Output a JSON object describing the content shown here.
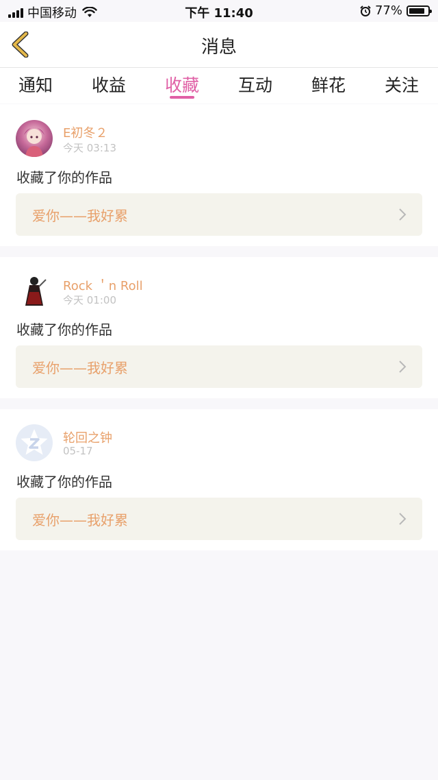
{
  "status": {
    "carrier": "中国移动",
    "time": "下午 11:40",
    "battery": "77%"
  },
  "nav": {
    "title": "消息"
  },
  "tabs": [
    {
      "label": "通知"
    },
    {
      "label": "收益"
    },
    {
      "label": "收藏"
    },
    {
      "label": "互动"
    },
    {
      "label": "鲜花"
    },
    {
      "label": "关注"
    }
  ],
  "active_tab": "收藏",
  "items": [
    {
      "name": "E初冬２",
      "time": "今天 03:13",
      "action": "收藏了你的作品",
      "work": "爱你——我好累"
    },
    {
      "name": "Rock ＇n Roll",
      "time": "今天 01:00",
      "action": "收藏了你的作品",
      "work": "爱你——我好累"
    },
    {
      "name": "轮回之钟",
      "time": "05-17",
      "action": "收藏了你的作品",
      "work": "爱你——我好累"
    }
  ],
  "colors": {
    "accent": "#e060a6",
    "name": "#e8a06a",
    "work_bg": "#f4f3ec",
    "page_bg": "#f8f7fa",
    "back_arrow": "#e4b84a"
  }
}
